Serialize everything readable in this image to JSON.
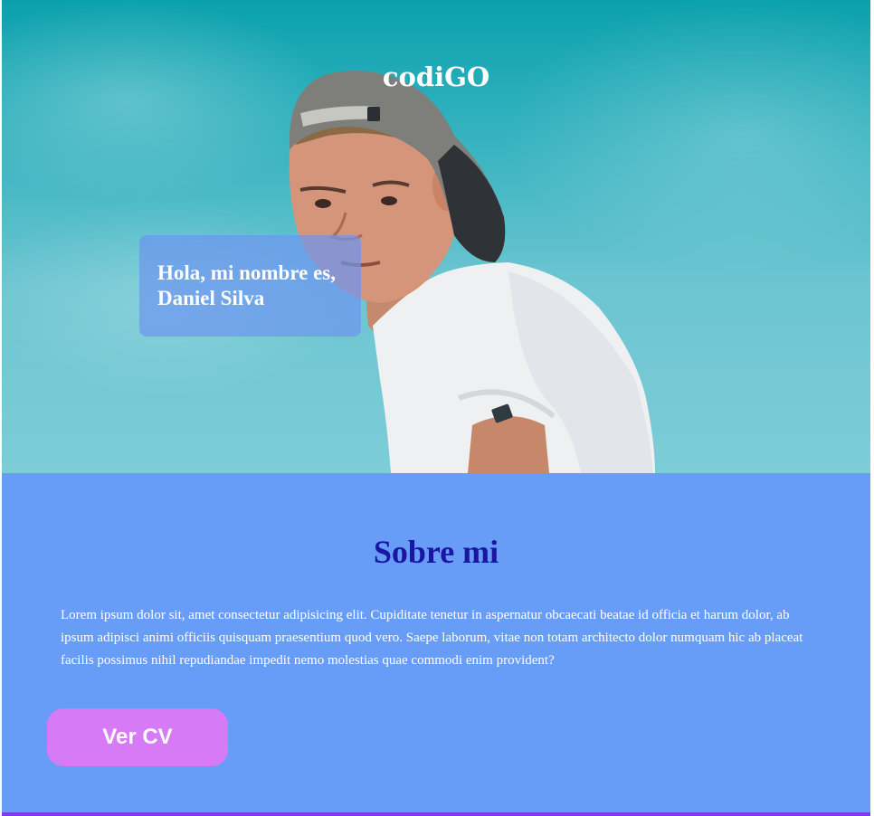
{
  "header": {
    "brand": "codiGO"
  },
  "hero": {
    "greeting_line1": "Hola, mi nombre es,",
    "greeting_line2": "Daniel Silva",
    "photo_subject": "young man wearing backwards cap and white t-shirt against blue sky"
  },
  "about": {
    "title": "Sobre mi",
    "text": "Lorem ipsum dolor sit, amet consectetur adipisicing elit. Cupiditate tenetur in aspernatur obcaecati beatae id officia et harum dolor, ab ipsum adipisci animi officiis quisquam praesentium quod vero. Saepe laborum, vitae non totam architecto dolor numquam hic ab placeat facilis possimus nihil repudiandae impedit nemo molestias quae commodi enim provident?",
    "cv_button_label": "Ver CV"
  },
  "colors": {
    "about_background": "#679df7",
    "about_title": "#1a16a4",
    "cv_button": "#d67af6",
    "bottom_bar": "#7a3cf0"
  }
}
